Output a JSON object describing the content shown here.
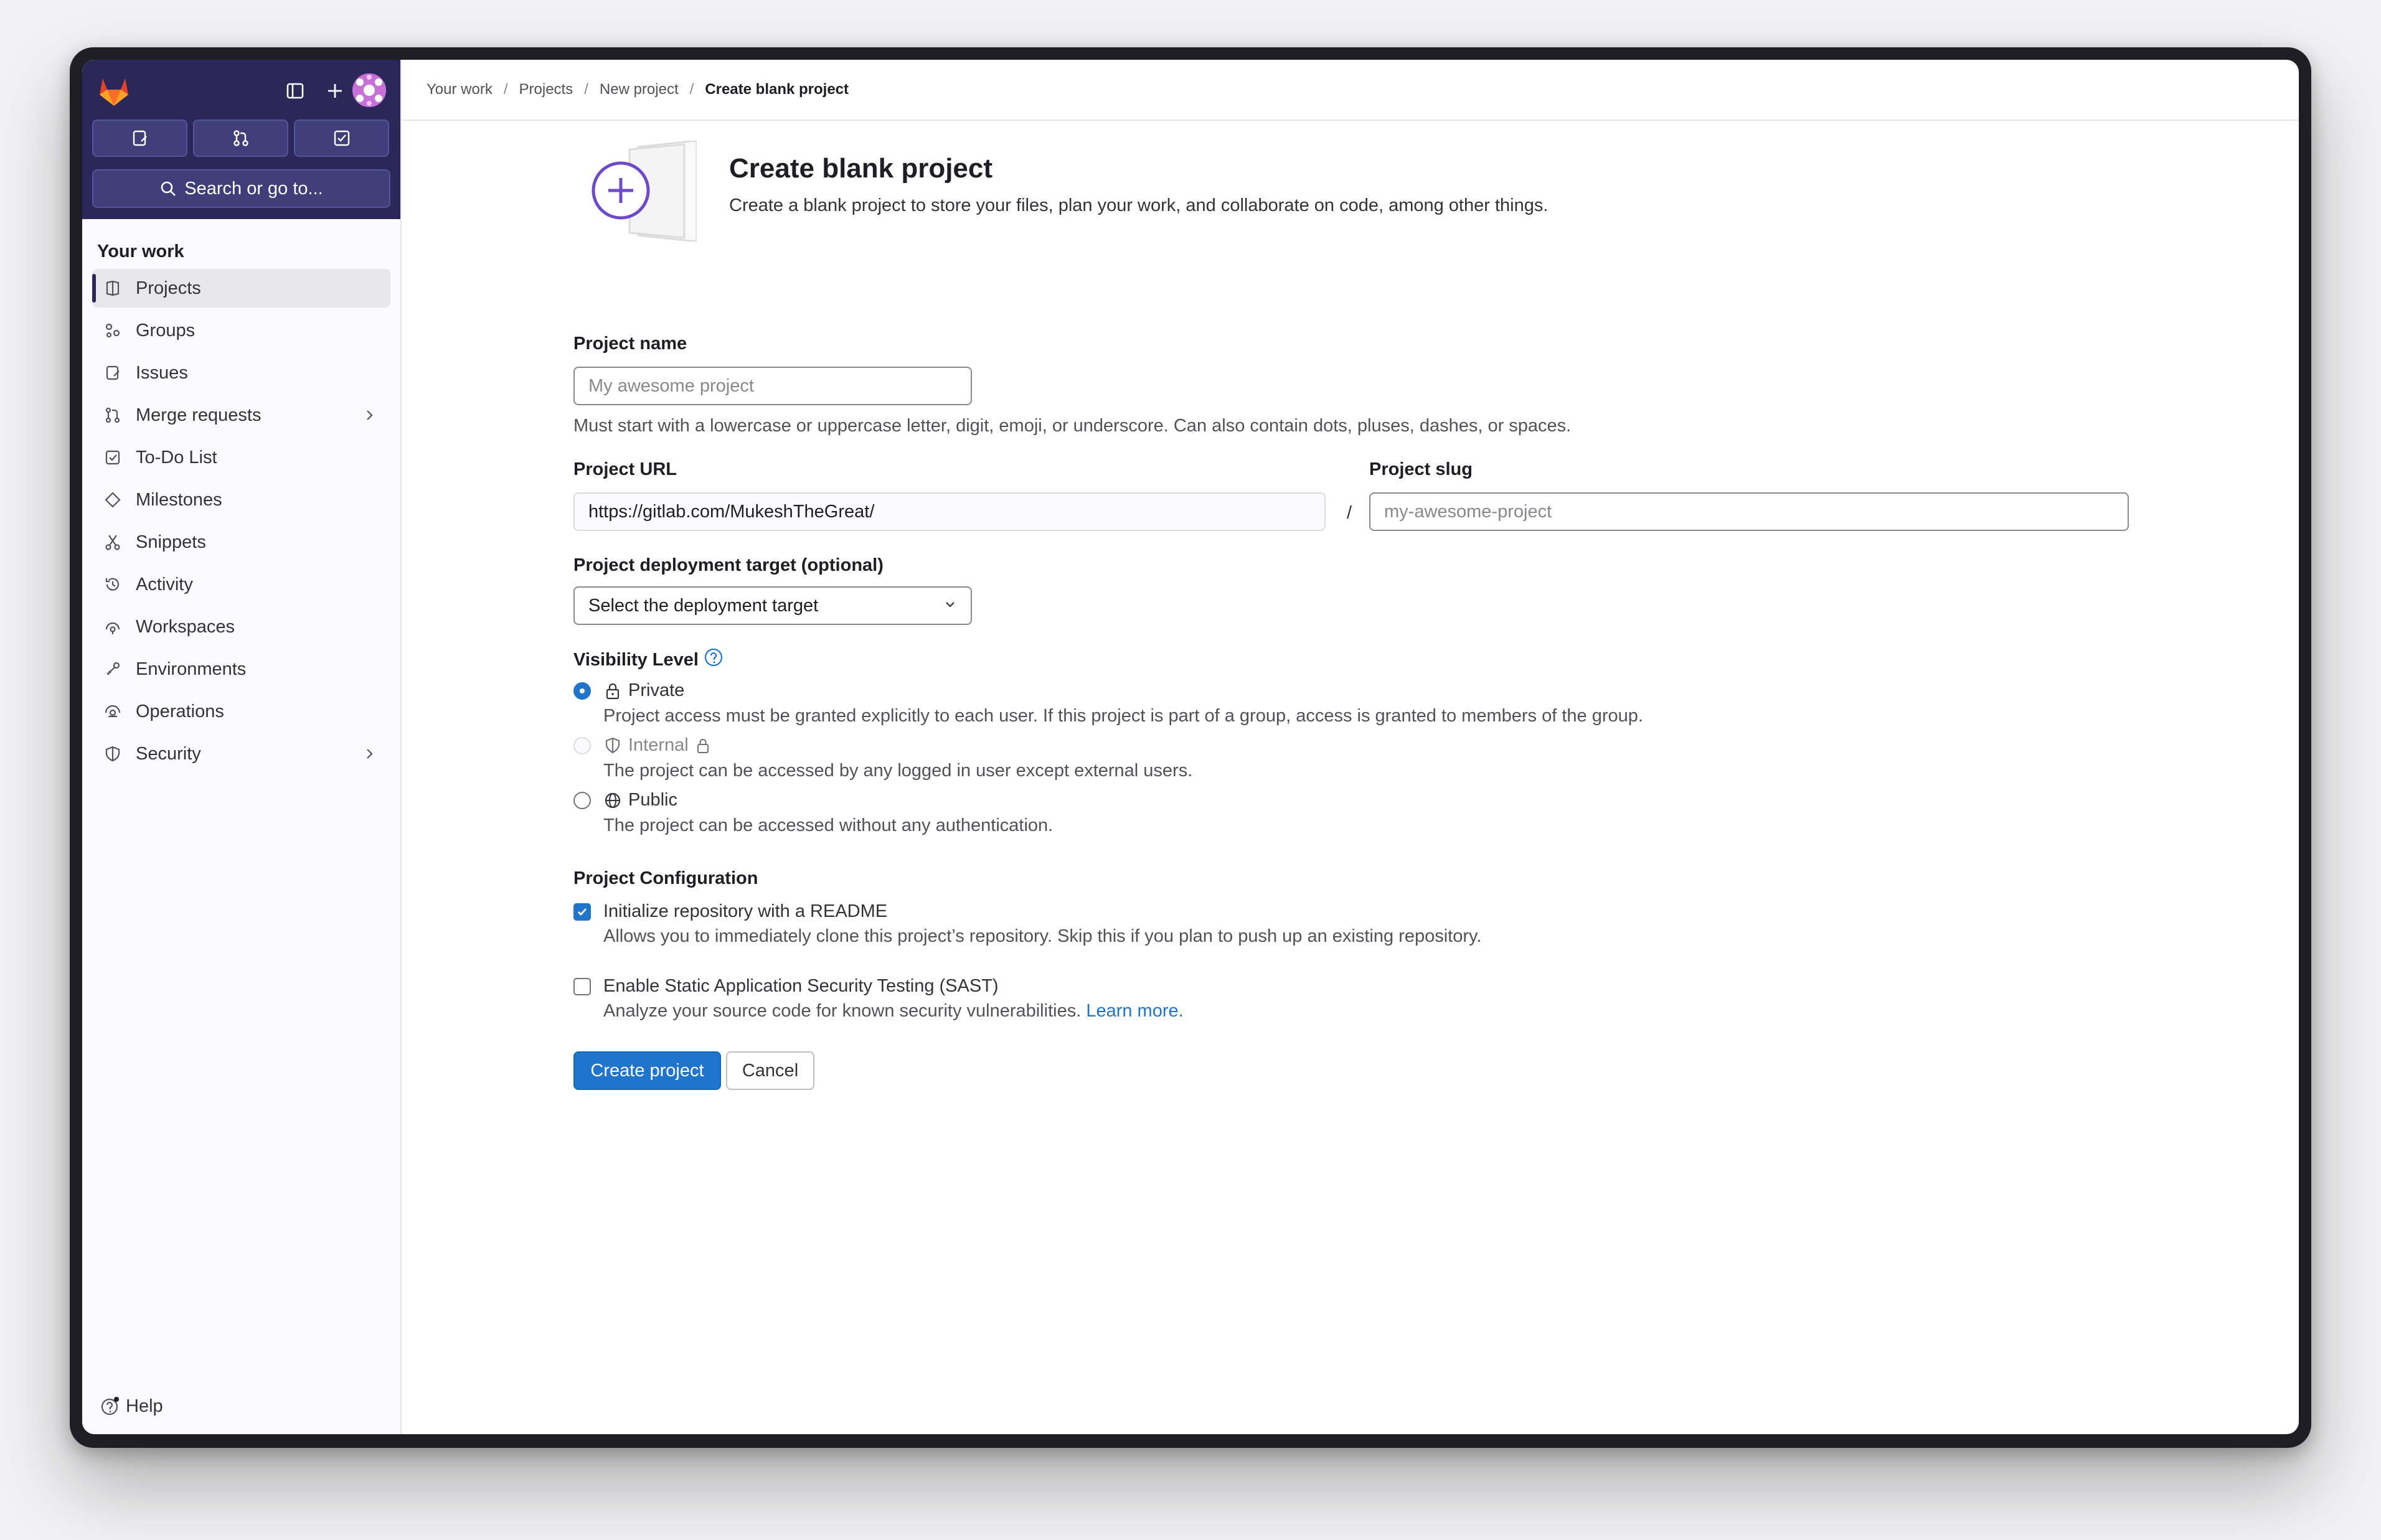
{
  "sidebar": {
    "section_title": "Your work",
    "search_label": "Search or go to...",
    "items": [
      {
        "label": "Projects",
        "icon": "project-icon"
      },
      {
        "label": "Groups",
        "icon": "group-icon"
      },
      {
        "label": "Issues",
        "icon": "issues-icon"
      },
      {
        "label": "Merge requests",
        "icon": "merge-request-icon"
      },
      {
        "label": "To-Do List",
        "icon": "todo-icon"
      },
      {
        "label": "Milestones",
        "icon": "milestone-icon"
      },
      {
        "label": "Snippets",
        "icon": "snippet-icon"
      },
      {
        "label": "Activity",
        "icon": "history-icon"
      },
      {
        "label": "Workspaces",
        "icon": "workspace-icon"
      },
      {
        "label": "Environments",
        "icon": "environment-icon"
      },
      {
        "label": "Operations",
        "icon": "operations-icon"
      },
      {
        "label": "Security",
        "icon": "shield-icon"
      }
    ],
    "help_label": "Help"
  },
  "breadcrumb": {
    "items": [
      "Your work",
      "Projects",
      "New project"
    ],
    "current": "Create blank project",
    "separator": "/"
  },
  "page": {
    "title": "Create blank project",
    "description": "Create a blank project to store your files, plan your work, and collaborate on code, among other things."
  },
  "form": {
    "project_name": {
      "label": "Project name",
      "placeholder": "My awesome project",
      "help": "Must start with a lowercase or uppercase letter, digit, emoji, or underscore. Can also contain dots, pluses, dashes, or spaces."
    },
    "project_url": {
      "label": "Project URL",
      "value": "https://gitlab.com/MukeshTheGreat/",
      "separator": "/"
    },
    "project_slug": {
      "label": "Project slug",
      "placeholder": "my-awesome-project"
    },
    "deployment_target": {
      "label": "Project deployment target (optional)",
      "selected": "Select the deployment target"
    },
    "visibility": {
      "label": "Visibility Level",
      "options": [
        {
          "label": "Private",
          "description": "Project access must be granted explicitly to each user. If this project is part of a group, access is granted to members of the group.",
          "checked": true
        },
        {
          "label": "Internal",
          "description": "The project can be accessed by any logged in user except external users.",
          "disabled": true
        },
        {
          "label": "Public",
          "description": "The project can be accessed without any authentication."
        }
      ]
    },
    "configuration": {
      "label": "Project Configuration",
      "readme": {
        "label": "Initialize repository with a README",
        "description": "Allows you to immediately clone this project’s repository. Skip this if you plan to push up an existing repository.",
        "checked": true
      },
      "sast": {
        "label": "Enable Static Application Security Testing (SAST)",
        "description": "Analyze your source code for known security vulnerabilities.",
        "link": "Learn more.",
        "checked": false
      }
    },
    "buttons": {
      "create": "Create project",
      "cancel": "Cancel"
    }
  },
  "colors": {
    "sidebar_top": "#2b2859",
    "primary": "#1f75cb",
    "logo": "#e24329"
  }
}
